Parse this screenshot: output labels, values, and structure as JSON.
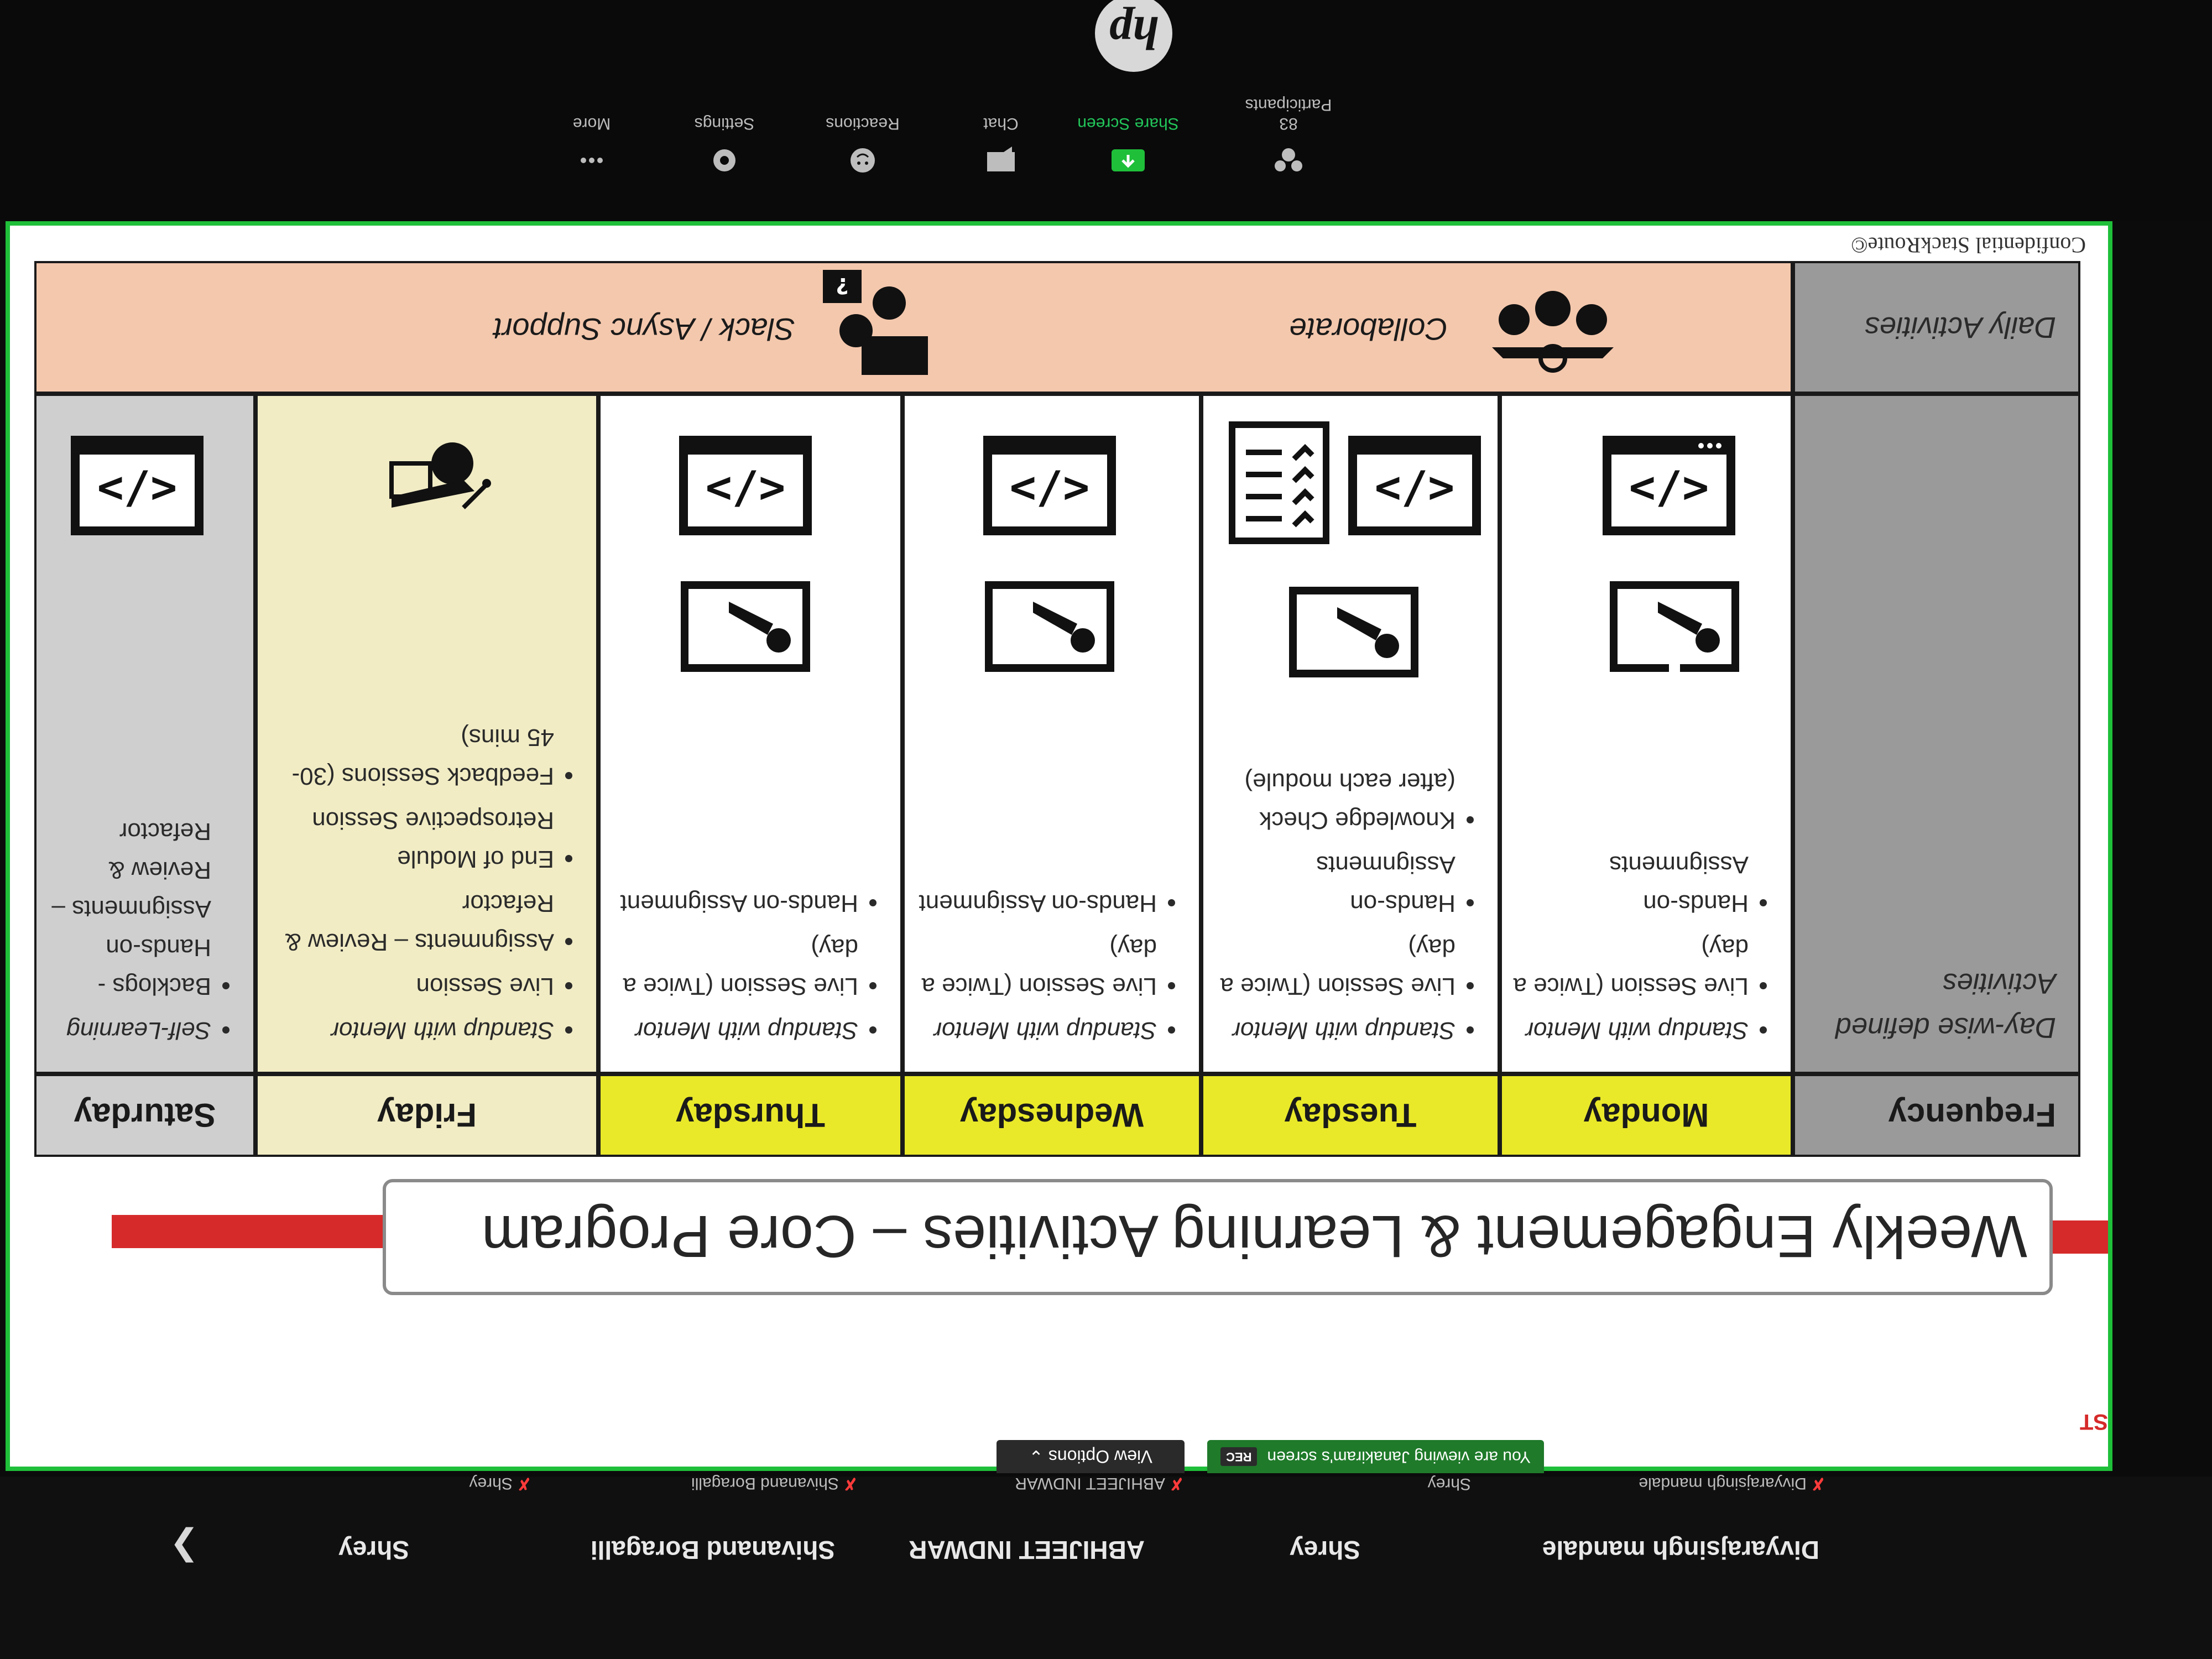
{
  "participants_bar": {
    "names": [
      "Divyarajsingh mandale",
      "Shrey",
      "ABHIJEET INDWAR",
      "Shivanand Boragalli",
      "Shrey"
    ],
    "small_names": [
      "Divyarajsingh mandale",
      "Shrey",
      "ABHIJEET INDWAR",
      "Shivanand Boragalli",
      "Shrey"
    ],
    "next_icon": "chevron-right-icon"
  },
  "share_banner": {
    "viewing_text": "You are viewing Janakiram's screen",
    "rec_label": "REC",
    "view_options_label": "View Options"
  },
  "slide": {
    "brand_side": "ST",
    "title": "Weekly Engagement & Learning Activities – Core Program",
    "headers": {
      "frequency": "Frequency",
      "days": [
        "Monday",
        "Tuesday",
        "Wednesday",
        "Thursday",
        "Friday",
        "Saturday"
      ]
    },
    "row_label_daywise": "Day-wise defined Activities",
    "day_activities": [
      [
        "Standup with Mentor",
        "Live Session (Twice a day)",
        "Hands-on Assignments"
      ],
      [
        "Standup with Mentor",
        "Live Session (Twice a day)",
        "Hands-on Assignments",
        "Knowledge Check (after each module)"
      ],
      [
        "Standup with Mentor",
        "Live Session (Twice a day)",
        "Hands-on Assignment"
      ],
      [
        "Standup with Mentor",
        "Live Session (Twice a day)",
        "Hands-on Assignment"
      ],
      [
        "Standup with Mentor",
        "Live Session",
        "Assignments – Review & Refactor",
        "End of Module Retrospective Session",
        "Feedback Sessions (30-45 mins)"
      ],
      [
        "Self-Learning",
        "Backlogs - Hands-on Assignments – Review & Refactor"
      ]
    ],
    "row_label_daily": "Daily Activities",
    "daily_items": [
      "Collaborate",
      "Slack / Async Support"
    ],
    "footer": "Confidential StackRoute©",
    "colors": {
      "day_header": "#e9e92a",
      "friday_bg": "#f1ecc4",
      "saturday_bg": "#cfcfcf",
      "label_col_bg": "#9a9a9a",
      "daily_bg": "#f4c8ad",
      "title_accent": "#d62a2a"
    }
  },
  "toolbar": {
    "participants_label": "Participants",
    "participants_count": "83",
    "share_label": "Share Screen",
    "chat_label": "Chat",
    "reactions_label": "Reactions",
    "settings_label": "Settings",
    "more_label": "More",
    "brand": "hp"
  }
}
